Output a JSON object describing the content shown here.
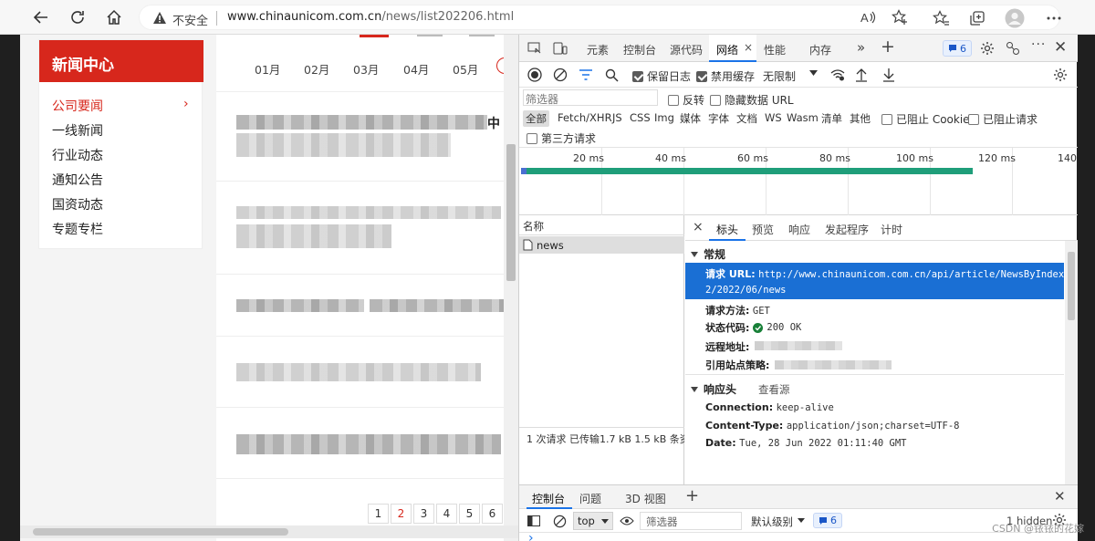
{
  "browser": {
    "insecure_label": "不安全",
    "url_host": "www.chinaunicom.com.cn",
    "url_path": "/news/list202206.html"
  },
  "site": {
    "panel_title": "新闻中心",
    "menu": [
      {
        "label": "公司要闻",
        "active": true
      },
      {
        "label": "一线新闻"
      },
      {
        "label": "行业动态"
      },
      {
        "label": "通知公告"
      },
      {
        "label": "国资动态"
      },
      {
        "label": "专题专栏"
      }
    ],
    "months": [
      "01月",
      "02月",
      "03月",
      "04月",
      "05月"
    ],
    "pages": [
      "1",
      "2",
      "3",
      "4",
      "5",
      "6"
    ],
    "current_page": "2",
    "fragment_text": "中"
  },
  "devtools": {
    "tabs": [
      "元素",
      "控制台",
      "源代码",
      "网络",
      "性能",
      "内存"
    ],
    "selected_tab": "网络",
    "issue_count": "6",
    "toolbar": {
      "preserve_log": "保留日志",
      "disable_cache": "禁用缓存",
      "throttle": "无限制"
    },
    "filter": {
      "placeholder": "筛选器",
      "invert": "反转",
      "hide_data_url": "隐藏数据 URL",
      "types": [
        "全部",
        "Fetch/XHR",
        "JS",
        "CSS",
        "Img",
        "媒体",
        "字体",
        "文档",
        "WS",
        "Wasm",
        "清单",
        "其他"
      ],
      "blocked_cookies": "已阻止 Cookie",
      "blocked_requests": "已阻止请求",
      "third_party": "第三方请求"
    },
    "timeline_labels": [
      "20 ms",
      "40 ms",
      "60 ms",
      "80 ms",
      "100 ms",
      "120 ms",
      "140"
    ],
    "request_list": {
      "header": "名称",
      "row": "news",
      "status": "1 次请求  已传输1.7 kB  1.5 kB 条资"
    },
    "details": {
      "tabs": [
        "标头",
        "预览",
        "响应",
        "发起程序",
        "计时"
      ],
      "general_label": "常规",
      "request_url_key": "请求 URL:",
      "request_url_line1": "http://www.chinaunicom.com.cn/api/article/NewsByIndex/",
      "request_url_line2": "2/2022/06/news",
      "method_key": "请求方法:",
      "method_val": "GET",
      "status_key": "状态代码:",
      "status_val": "200 OK",
      "remote_key": "远程地址:",
      "referrer_key": "引用站点策略:",
      "response_headers_label": "响应头",
      "view_source": "查看源",
      "connection_key": "Connection:",
      "connection_val": "keep-alive",
      "ctype_key": "Content-Type:",
      "ctype_val": "application/json;charset=UTF-8",
      "date_key": "Date:",
      "date_val": "Tue, 28 Jun 2022 01:11:40 GMT"
    },
    "drawer": {
      "tabs": [
        "控制台",
        "问题",
        "3D 视图"
      ],
      "context": "top",
      "filter_placeholder": "筛选器",
      "level": "默认级别",
      "issue_count": "6",
      "hidden": "1 hidden",
      "prompt": "›"
    }
  },
  "watermark": "CSDN @铱铱的花嫁",
  "colors": {
    "brand_red": "#d7271c",
    "selection_blue": "#1a6fd4",
    "timeline_green": "#1f9e7a"
  }
}
